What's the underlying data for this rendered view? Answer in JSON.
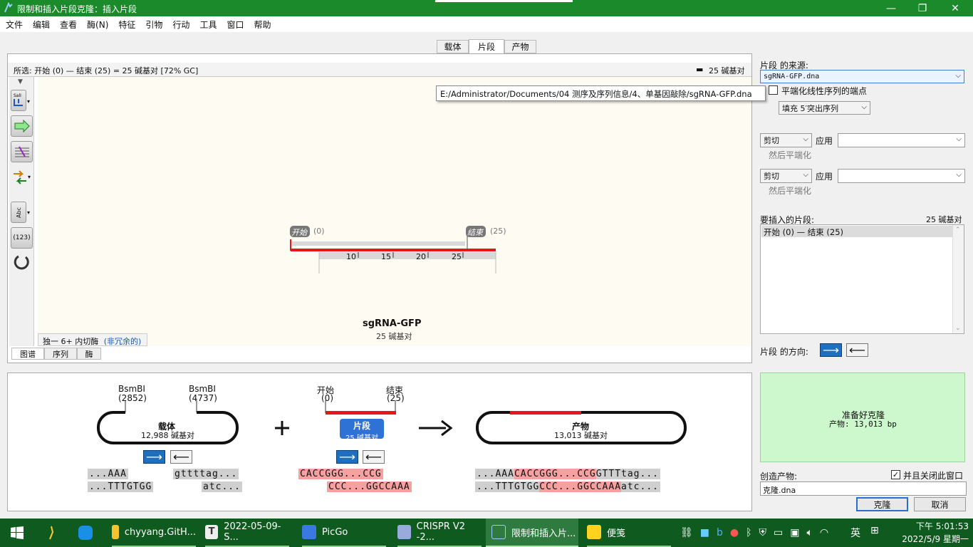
{
  "window": {
    "title": "限制和插入片段克隆：插入片段"
  },
  "menu": [
    "文件",
    "编辑",
    "查看",
    "酶(N)",
    "特征",
    "引物",
    "行动",
    "工具",
    "窗口",
    "帮助"
  ],
  "tabs": [
    "载体",
    "片段",
    "产物"
  ],
  "active_tab": "片段",
  "map_header": {
    "selection": "所选:  开始 (0) — 结束 (25) = 25 碱基对     [72% GC]",
    "length": "25 碱基对"
  },
  "map": {
    "start_label": "开始",
    "start_pos": "(0)",
    "end_label": "结束",
    "end_pos": "(25)",
    "ticks": [
      "10",
      "15",
      "20",
      "25"
    ],
    "name": "sgRNA-GFP",
    "length": "25 碱基对",
    "enzyme_filter": "独一 6+ 内切酶",
    "enzyme_filter_note": "(非冗余的)"
  },
  "map_tabs": [
    "图谱",
    "序列",
    "酶"
  ],
  "toolbar": {
    "enzyme_icon_label": "SalI",
    "abc_label": "Abc",
    "num_label": "(123)"
  },
  "right": {
    "source_label": "片段 的来源:",
    "source_file": "sgRNA-GFP.dna",
    "tooltip_path": "E:/Administrator/Documents/04 测序及序列信息/4、单基因敲除/sgRNA-GFP.dna",
    "blunt_label": "平端化线性序列的端点",
    "fill_option": "填充 5′突出序列",
    "cut1": "剪切",
    "apply1": "应用",
    "then_blunt1": "然后平端化",
    "cut2": "剪切",
    "apply2": "应用",
    "then_blunt2": "然后平端化",
    "insert_label": "要插入的片段:",
    "insert_len": "25 碱基对",
    "insert_item": "开始  (0)   —    结束  (25)",
    "orientation_label": "片段 的方向:",
    "status_title": "准备好克隆",
    "status_product": "产物:  13,013 bp",
    "create_label": "创造产物:",
    "close_label": "并且关闭此窗口",
    "product_name": "克隆.dna",
    "clone_btn": "克隆",
    "cancel_btn": "取消"
  },
  "diagram": {
    "vector": {
      "site1_name": "BsmBI",
      "site1_pos": "(2852)",
      "site2_name": "BsmBI",
      "site2_pos": "(4737)",
      "name": "载体",
      "length": "12,988 碱基对",
      "seq_top_left": "...AAA",
      "seq_top_right": "gttttag...",
      "seq_bot_left": "...TTTGTGG",
      "seq_bot_right": "atc..."
    },
    "fragment": {
      "start_name": "开始",
      "start_pos": "(0)",
      "end_name": "结束",
      "end_pos": "(25)",
      "name": "片段",
      "length": "25 碱基对",
      "seq_top": "CACCGGG...CCG",
      "seq_bot": "CCC...GGCCAAA"
    },
    "product": {
      "name": "产物",
      "length": "13,013 碱基对",
      "seq_top_a": "...AAA",
      "seq_top_b": "CACCGGG...CCG",
      "seq_top_c": "GTTTtag...",
      "seq_bot_a": "...TTTGTGG",
      "seq_bot_b": "CCC...GGCCAAA",
      "seq_bot_c": "atc..."
    }
  },
  "taskbar": {
    "items": [
      "chyyang.GitH...",
      "2022-05-09-S...",
      "PicGo",
      "CRISPR V2 -2...",
      "限制和插入片...",
      "便笺"
    ],
    "clock_time": "下午 5:01:53",
    "clock_date": "2022/5/9 星期一",
    "ime": "英"
  },
  "colors": {
    "titlebar": "#1a8a2a",
    "taskbar": "#0f5a1e",
    "fragment_red": "#e8151a",
    "seq_pink": "#f6a0a0",
    "seq_gray": "#cfcfcf",
    "ready_green": "#cdf7cd"
  }
}
